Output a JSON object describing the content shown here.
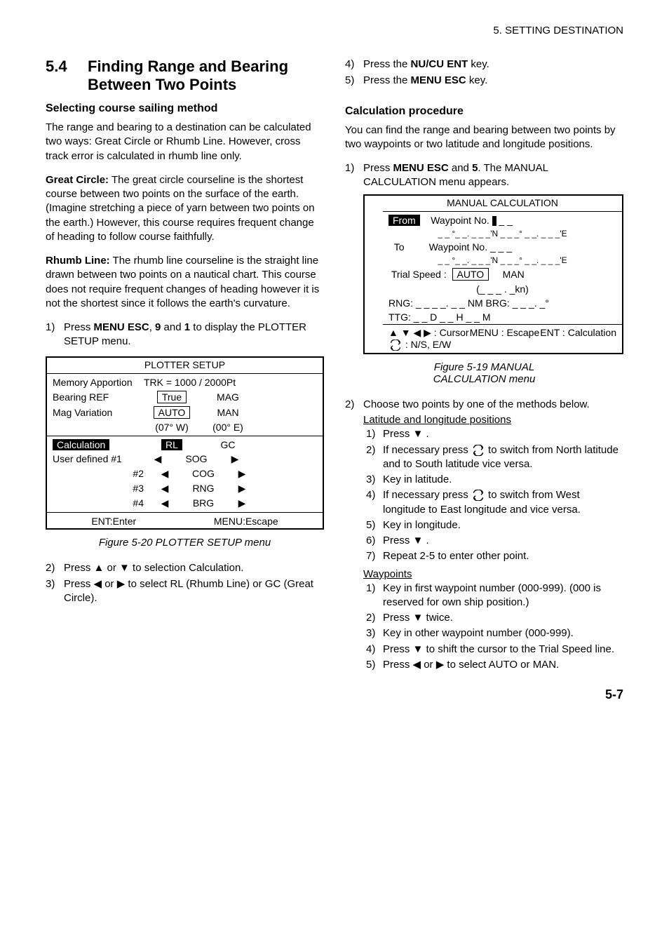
{
  "running_head": "5.  SETTING  DESTINATION",
  "section": {
    "number": "5.4",
    "title": "Finding Range and Bearing Between Two Points"
  },
  "left": {
    "sub1": "Selecting course sailing method",
    "para1": "The range and bearing to a destination can be calculated two ways: Great Circle or Rhumb Line. However, cross track error is calculated in rhumb line only.",
    "gc_label": "Great Circle:",
    "gc_text": " The great circle courseline is the shortest course between two points on the surface of the earth. (Imagine stretching a piece of yarn between two points on the earth.) However, this course requires frequent change of heading to follow course faithfully.",
    "rl_label": "Rhumb Line:",
    "rl_text": " The rhumb line courseline is the straight line drawn between two points on a nautical chart. This course does not require frequent changes of heading however it is not the shortest since it follows the earth's curvature.",
    "step1_pre": "Press ",
    "step1_k1": "MENU ESC",
    "step1_mid": ", ",
    "step1_k2": "9",
    "step1_mid2": " and ",
    "step1_k3": "1",
    "step1_post": " to display the PLOTTER SETUP menu.",
    "plotter": {
      "title": "PLOTTER SETUP",
      "mem": "Memory Apportion",
      "trk": "TRK = 1000 / 2000Pt",
      "bearing": "Bearing REF",
      "true": "True",
      "mag": "MAG",
      "magvar": "Mag Variation",
      "auto": "AUTO",
      "man": "MAN",
      "w": "(07° W)",
      "e": "(00° E)",
      "calc": "Calculation",
      "rl": "RL",
      "gc": "GC",
      "ud": "User defined #1",
      "ud2": "#2",
      "ud3": "#3",
      "ud4": "#4",
      "sog": "SOG",
      "cog": "COG",
      "rng": "RNG",
      "brg": "BRG",
      "ent": "ENT:Enter",
      "esc": "MENU:Escape"
    },
    "caption1": "Figure 5-20 PLOTTER SETUP menu",
    "step2": "Press  ▲  or  ▼  to selection Calculation.",
    "step3": "Press  ◀  or  ▶  to select RL (Rhumb Line) or GC (Great Circle)."
  },
  "right": {
    "step4_pre": "Press the ",
    "step4_key": "NU/CU ENT",
    "step4_post": " key.",
    "step5_pre": "Press the ",
    "step5_key": "MENU ESC",
    "step5_post": " key.",
    "sub2": "Calculation procedure",
    "para2": "You can find the range and bearing between two points by two waypoints or two latitude and longitude positions.",
    "r1_pre": "Press ",
    "r1_k1": "MENU ESC",
    "r1_mid": " and ",
    "r1_k2": "5",
    "r1_post": ". The MANUAL CALCULATION menu appears.",
    "manual": {
      "title": "MANUAL CALCULATION",
      "from": "From",
      "wpt": "Waypoint No.",
      "to": "To",
      "lat1": "_ _  °_ _.  _ _ _'N    _ _ _°  _ _.  _ _ _'E",
      "lat2": "_ _  °_ _.  _ _ _'N    _ _ _°  _ _.  _ _ _'E",
      "trial": "Trial Speed :",
      "auto": "AUTO",
      "man": "MAN",
      "kn": "(_ _ _ . _kn)",
      "rng": "RNG:   _ _ _ _. _ _ NM     BRG: _ _ _. _°",
      "ttg": "TTG:   _ _ D _ _ H _ _ M",
      "cursor": ": Cursor",
      "menu": "MENU : Escape",
      "ent": "ENT : Calculation",
      "nse": " : N/S, E/W"
    },
    "caption2a": "Figure 5-19 MANUAL",
    "caption2b": "CALCULATION menu",
    "r2": "Choose two points by one of the methods below.",
    "latlon_head": "Latitude and longitude positions",
    "ll": {
      "s1": "Press  ▼ .",
      "s2a": "If necessary press  ",
      "s2b": "  to switch from North latitude and to South latitude vice versa.",
      "s3": "Key in latitude.",
      "s4a": "If necessary press  ",
      "s4b": "  to switch from West longitude to East longitude and vice versa.",
      "s5": "Key in longitude.",
      "s6": "Press  ▼ .",
      "s7": "Repeat 2-5 to enter other point."
    },
    "wpt_head": "Waypoints",
    "wp": {
      "s1": "Key in first waypoint number (000-999). (000 is reserved for own ship position.)",
      "s2": "Press  ▼  twice.",
      "s3": "Key in other waypoint number (000-999).",
      "s4": "Press  ▼  to shift the cursor to the Trial Speed line.",
      "s5": "Press  ◀  or  ▶  to select AUTO or MAN."
    }
  },
  "page_number": "5-7"
}
